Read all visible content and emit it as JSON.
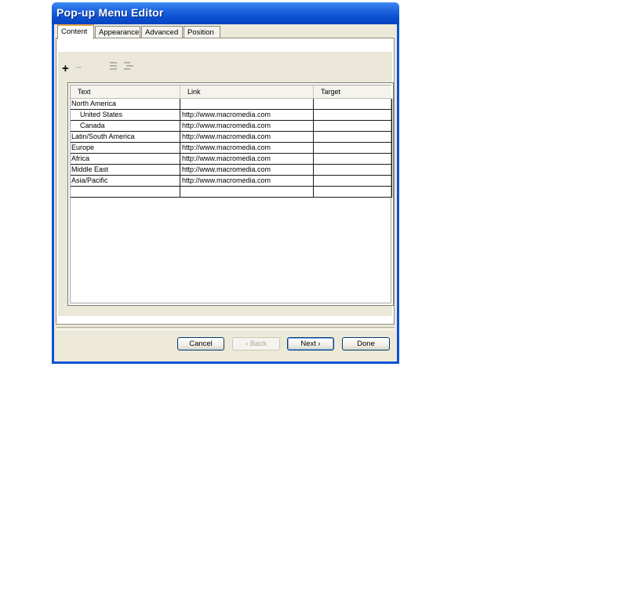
{
  "window": {
    "title": "Pop-up Menu Editor"
  },
  "tabs": [
    "Content",
    "Appearance",
    "Advanced",
    "Position"
  ],
  "toolbar": {
    "add": "+",
    "remove": "−"
  },
  "table": {
    "columns": [
      "Text",
      "Link",
      "Target"
    ],
    "rows": [
      {
        "text": "North America",
        "link": "",
        "target": ""
      },
      {
        "text": "United States",
        "link": "http://www.macromedia.com",
        "target": ""
      },
      {
        "text": "Canada",
        "link": "http://www.macromedia.com",
        "target": ""
      },
      {
        "text": "Latin/South America",
        "link": "http://www.macromedia.com",
        "target": ""
      },
      {
        "text": "Europe",
        "link": "http://www.macromedia.com",
        "target": ""
      },
      {
        "text": "Africa",
        "link": "http://www.macromedia.com",
        "target": ""
      },
      {
        "text": "Middle East",
        "link": "http://www.macromedia.com",
        "target": ""
      },
      {
        "text": "Asia/Pacific",
        "link": "http://www.macromedia.com",
        "target": ""
      },
      {
        "text": "",
        "link": "",
        "target": ""
      }
    ]
  },
  "buttons": {
    "cancel": "Cancel",
    "back": "‹ Back",
    "next": "Next ›",
    "done": "Done"
  }
}
